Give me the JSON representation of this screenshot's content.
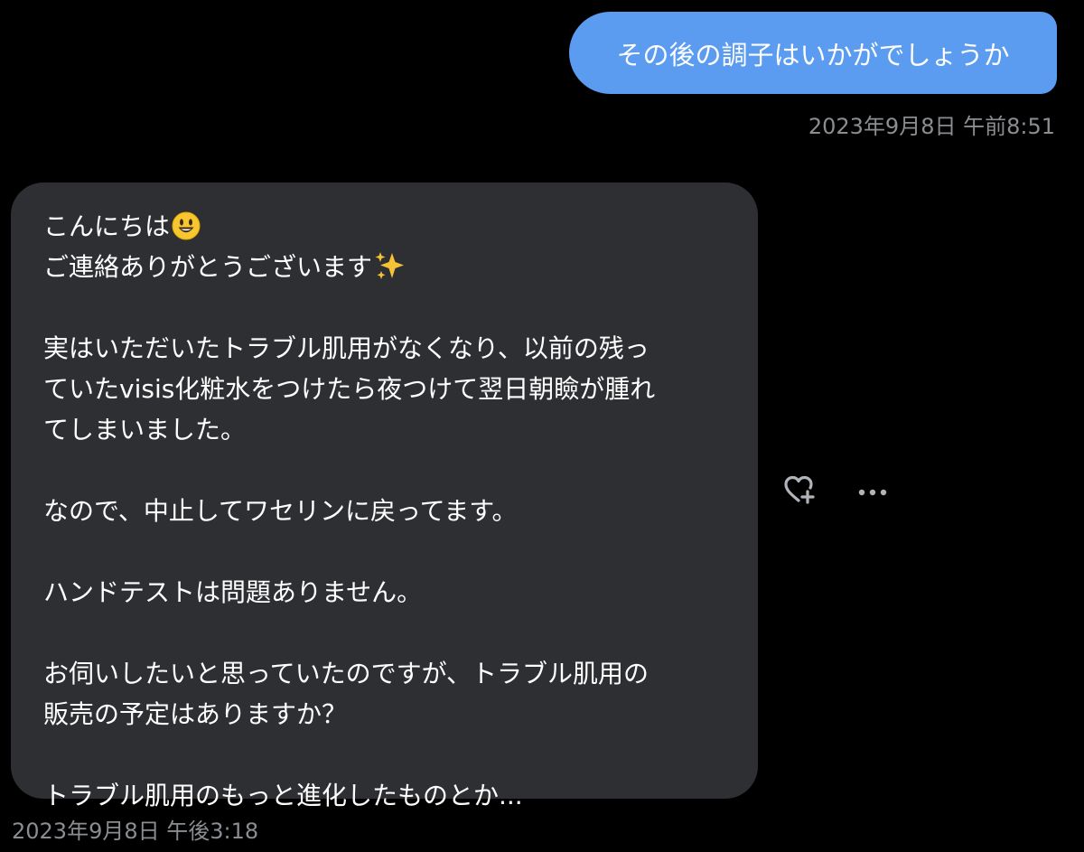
{
  "outgoing_message": {
    "text": "その後の調子はいかがでしょうか",
    "timestamp": "2023年9月8日 午前8:51",
    "bubble_color": "#5b9cf0"
  },
  "incoming_message": {
    "lines": {
      "greeting": "こんにちは",
      "thanks": "ご連絡ありがとうございます",
      "p1_l1": "実はいただいたトラブル肌用がなくなり、以前の残っ",
      "p1_l2": "ていたvisis化粧水をつけたら夜つけて翌日朝瞼が腫れ",
      "p1_l3": "てしまいました。",
      "p2_l1": "なので、中止してワセリンに戻ってます。",
      "p3_l1": "ハンドテストは問題ありません。",
      "p4_l1": "お伺いしたいと思っていたのですが、トラブル肌用の",
      "p4_l2": "販売の予定はありますか？",
      "p5_l1": "トラブル肌用のもっと進化したものとか..."
    },
    "emojis": {
      "greeting": "smiling-face-emoji",
      "thanks": "sparkles-emoji"
    },
    "timestamp": "2023年9月8日 午後3:18",
    "bubble_color": "#2e2f33"
  },
  "message_actions": {
    "react_icon": "heart-plus-icon",
    "more_icon": "more-options-icon",
    "icon_color": "#b0b3b8"
  },
  "colors": {
    "background": "#000000",
    "timestamp_text": "#8a8d91"
  }
}
